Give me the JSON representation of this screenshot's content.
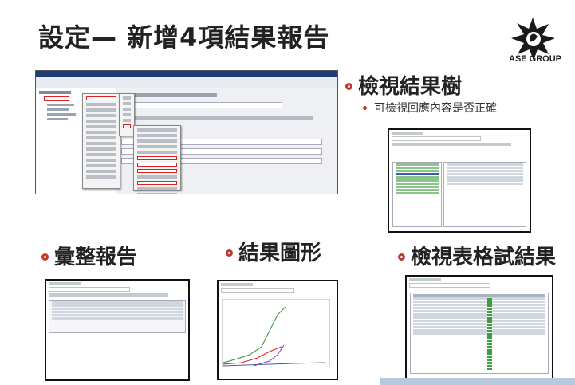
{
  "slide": {
    "title": "設定— 新增4項結果報告"
  },
  "logo": {
    "text": "ASE GROUP",
    "icon": "ase-star-logo-icon"
  },
  "sections": {
    "view_results_tree": {
      "heading": "檢視結果樹",
      "sub": "可檢視回應內容是否正確"
    },
    "summary_report": {
      "heading": "彙整報告"
    },
    "graph_results": {
      "heading": "結果圖形"
    },
    "view_results_table": {
      "heading": "檢視表格試結果"
    }
  },
  "colors": {
    "accent": "#c0392b",
    "window_title": "#1e3c7a",
    "strip": "#b7c9dc"
  }
}
